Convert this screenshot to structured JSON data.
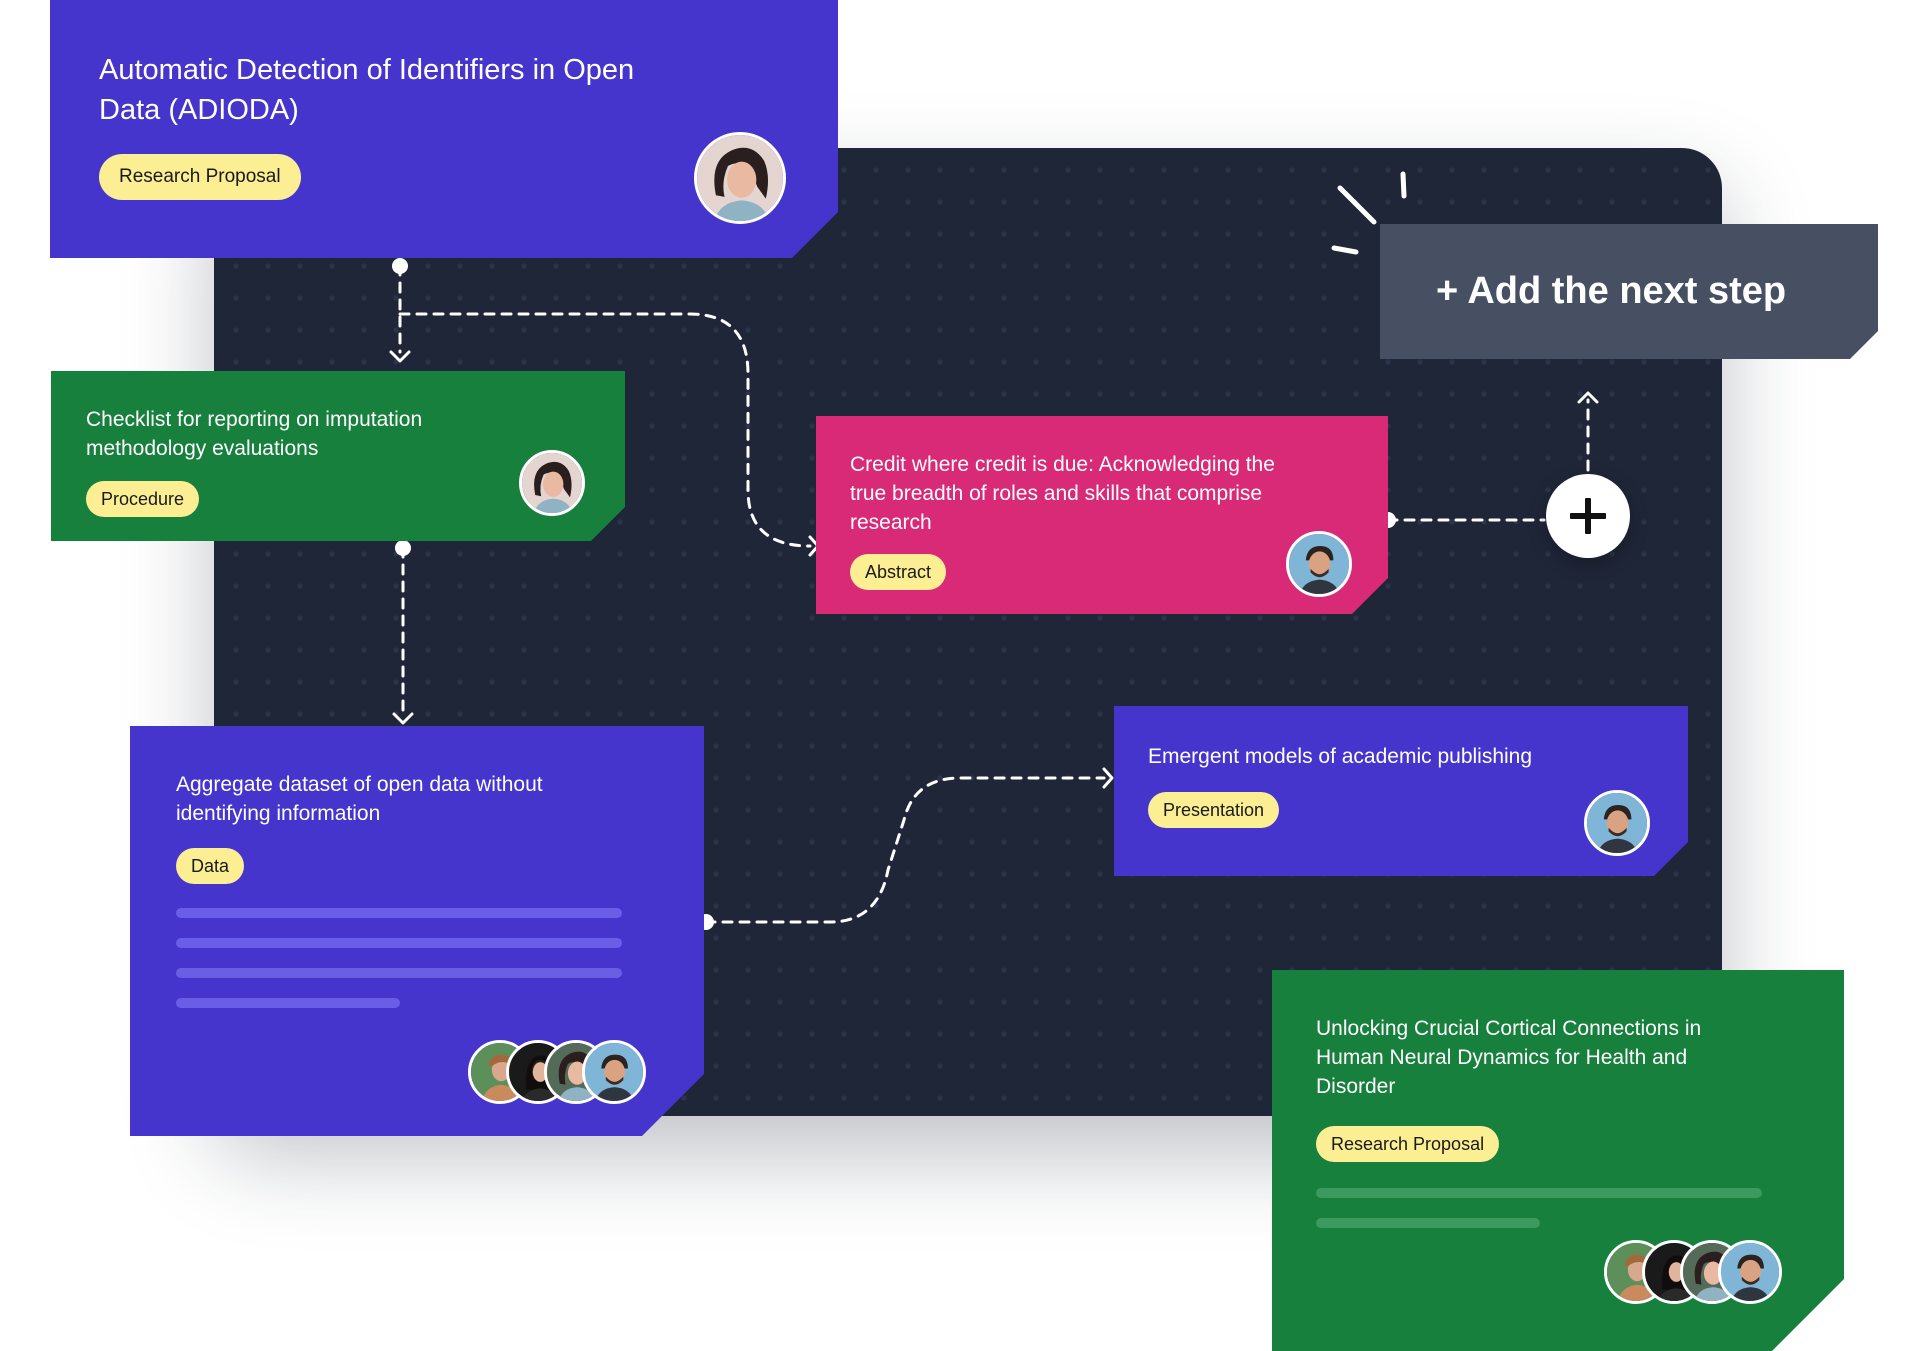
{
  "add_step": {
    "label": "+ Add the next step",
    "icon": "plus-icon"
  },
  "cards": {
    "adioda": {
      "title": "Automatic Detection of Identifiers in Open Data (ADIODA)",
      "badge": "Research Proposal",
      "color": "#4535cc"
    },
    "checklist": {
      "title": "Checklist for reporting on imputation methodology evaluations",
      "badge": "Procedure",
      "color": "#16803c"
    },
    "credit": {
      "title": "Credit where credit is due: Acknowledging the true breadth of roles and skills that comprise research",
      "badge": "Abstract",
      "color": "#d92a78"
    },
    "aggregate": {
      "title": "Aggregate dataset of open data without identifying information",
      "badge": "Data",
      "color": "#4535cc"
    },
    "emergent": {
      "title": "Emergent models of academic publishing",
      "badge": "Presentation",
      "color": "#4535cc"
    },
    "unlocking": {
      "title": "Unlocking Crucial Cortical Connections in Human Neural Dynamics for Health and Disorder",
      "badge": "Research Proposal",
      "color": "#16803c"
    }
  },
  "colors": {
    "canvas": "#1f2638",
    "badge": "#fcee92",
    "next_step": "#465062"
  }
}
